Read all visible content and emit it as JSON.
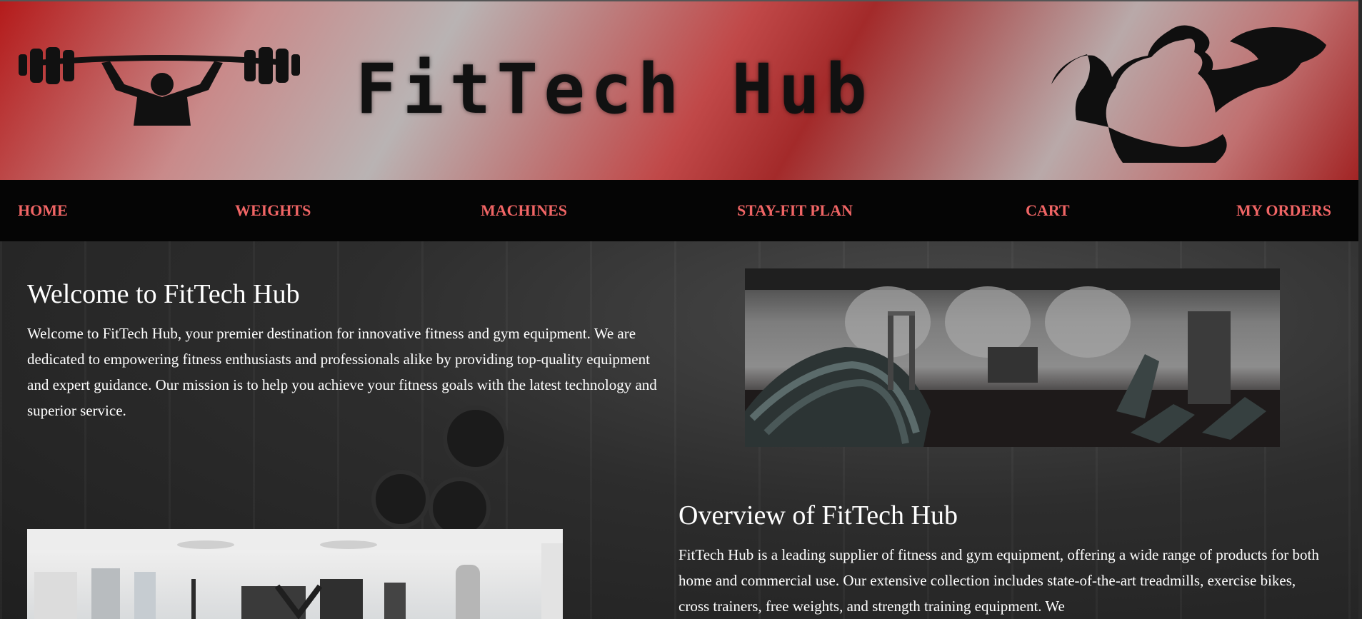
{
  "site": {
    "logo_text": "FitTech Hub"
  },
  "nav": {
    "items": [
      {
        "label": "HOME"
      },
      {
        "label": "WEIGHTS"
      },
      {
        "label": "MACHINES"
      },
      {
        "label": "STAY-FIT PLAN"
      },
      {
        "label": "CART"
      },
      {
        "label": "MY ORDERS"
      }
    ]
  },
  "welcome": {
    "heading": "Welcome to FitTech Hub",
    "body": "Welcome to FitTech Hub, your premier destination for innovative fitness and gym equipment. We are dedicated to empowering fitness enthusiasts and professionals alike by providing top-quality equipment and expert guidance. Our mission is to help you achieve your fitness goals with the latest technology and superior service."
  },
  "overview": {
    "heading": "Overview of FitTech Hub",
    "body": "FitTech Hub is a leading supplier of fitness and gym equipment, offering a wide range of products for both home and commercial use. Our extensive collection includes state-of-the-art treadmills, exercise bikes, cross trainers, free weights, and strength training equipment. We"
  },
  "icons": {
    "left_figure": "weightlifter-barbell-icon",
    "right_figure": "flexing-bodybuilder-icon"
  },
  "colors": {
    "nav_link": "#f06565",
    "nav_bg": "#050505",
    "banner_red": "#b41b1b"
  }
}
